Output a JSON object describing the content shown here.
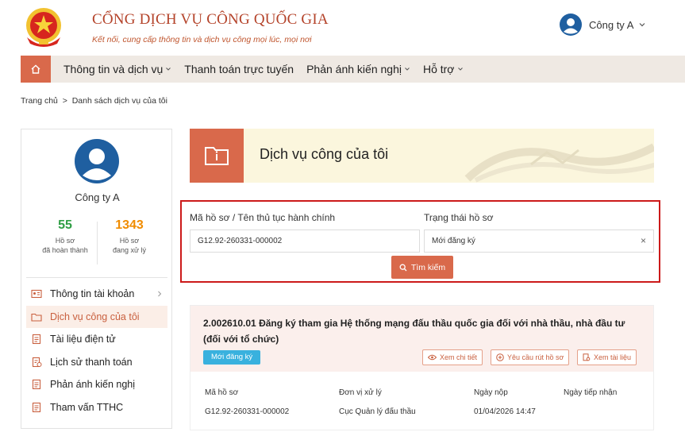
{
  "header": {
    "title": "CỔNG DỊCH VỤ CÔNG QUỐC GIA",
    "subtitle": "Kết nối, cung cấp thông tin và dịch vụ công mọi lúc, mọi nơi",
    "user_name": "Công ty A"
  },
  "nav": {
    "items": [
      {
        "label": "Thông tin và dịch vụ",
        "dropdown": true
      },
      {
        "label": "Thanh toán trực tuyến",
        "dropdown": false
      },
      {
        "label": "Phản ánh kiến nghị",
        "dropdown": true
      },
      {
        "label": "Hỗ trợ",
        "dropdown": true
      }
    ]
  },
  "breadcrumb": {
    "home": "Trang chủ",
    "separator": ">",
    "current": "Danh sách dịch vụ của tôi"
  },
  "sidebar": {
    "company_name": "Công ty A",
    "stats": [
      {
        "value": "55",
        "line1": "Hồ sơ",
        "line2": "đã hoàn thành",
        "color": "#2f9e44"
      },
      {
        "value": "1343",
        "line1": "Hồ sơ",
        "line2": "đang xử lý",
        "color": "#f08c00"
      }
    ],
    "menu": [
      {
        "label": "Thông tin tài khoản",
        "icon": "id-card-icon",
        "active": false,
        "arrow": true
      },
      {
        "label": "Dịch vụ công của tôi",
        "icon": "folder-icon",
        "active": true,
        "arrow": false
      },
      {
        "label": "Tài liệu điện tử",
        "icon": "document-icon",
        "active": false,
        "arrow": false
      },
      {
        "label": "Lịch sử thanh toán",
        "icon": "receipt-icon",
        "active": false,
        "arrow": false
      },
      {
        "label": "Phản ánh kiến nghị",
        "icon": "document-icon",
        "active": false,
        "arrow": false
      },
      {
        "label": "Tham vấn TTHC",
        "icon": "document-icon",
        "active": false,
        "arrow": false
      }
    ]
  },
  "banner": {
    "title": "Dịch vụ công của tôi"
  },
  "search": {
    "code_label": "Mã hồ sơ / Tên thủ tục hành chính",
    "code_value": "G12.92-260331-000002",
    "status_label": "Trạng thái hồ sơ",
    "status_value": "Mới đăng ký",
    "button_label": "Tìm kiếm"
  },
  "record": {
    "title": "2.002610.01 Đăng ký tham gia Hệ thống mạng đấu thầu quốc gia đối với nhà thầu, nhà đầu tư (đối với tổ chức)",
    "status_badge": "Mới đăng ký",
    "actions": [
      "Xem chi tiết",
      "Yêu cầu rút hồ sơ",
      "Xem tài liệu"
    ],
    "columns": [
      {
        "header": "Mã hồ sơ",
        "value": "G12.92-260331-000002"
      },
      {
        "header": "Đơn vị xử lý",
        "value": "Cục Quản lý đấu thầu"
      },
      {
        "header": "Ngày nộp",
        "value": "01/04/2026 14:47"
      },
      {
        "header": "Ngày tiếp nhận",
        "value": ""
      }
    ]
  },
  "colors": {
    "accent": "#d9694b",
    "highlight_border": "#cc1a1a",
    "badge": "#39b1de"
  }
}
